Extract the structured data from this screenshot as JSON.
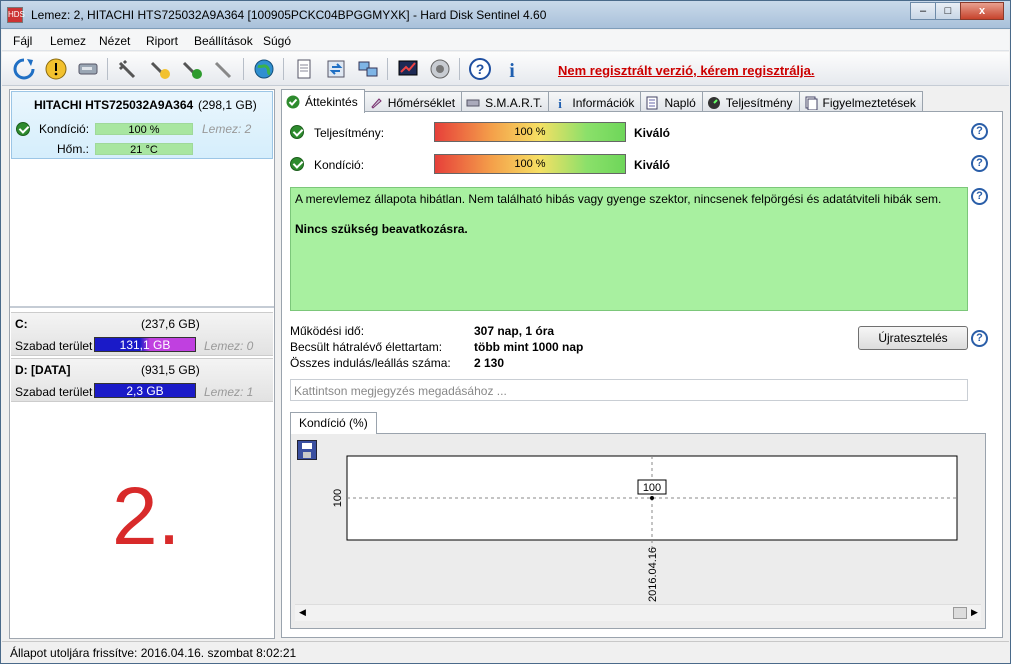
{
  "window": {
    "title": "Lemez: 2, HITACHI HTS725032A9A364 [100905PCKC04BPGGMYXK]  -  Hard Disk Sentinel 4.60",
    "app_icon_text": "HDS",
    "buttons": {
      "minimize": "–",
      "maximize": "□",
      "close": "x"
    }
  },
  "menu": [
    "Fájl",
    "Lemez",
    "Nézet",
    "Riport",
    "Beállítások",
    "Súgó"
  ],
  "toolbar": {
    "icons": [
      "refresh-icon",
      "warning-icon",
      "disk-icon",
      "plug-icon",
      "plug-warning-icon",
      "plug-ok-icon",
      "plug-gray-icon",
      "globe-icon",
      "document-icon",
      "sync-icon",
      "network-icon",
      "chart-icon",
      "speaker-icon",
      "help-icon",
      "info-icon"
    ],
    "registration_note": "Nem regisztrált verzió, kérem regisztrálja."
  },
  "sidebar": {
    "disk": {
      "name": "HITACHI HTS725032A9A364",
      "capacity": "(298,1 GB)",
      "condition_label": "Kondíció:",
      "condition_value": "100 %",
      "condition_percent": 100,
      "temp_label": "Hőm.:",
      "temp_value": "21 °C",
      "lemez": "Lemez: 2"
    },
    "volumes": [
      {
        "name": "C:",
        "capacity": "(237,6 GB)",
        "free_label": "Szabad terület",
        "free_value": "131,1 GB",
        "lemez": "Lemez: 0",
        "bar_color": "#b030d0"
      },
      {
        "name": "D: [DATA]",
        "capacity": "(931,5 GB)",
        "free_label": "Szabad terület",
        "free_value": "2,3 GB",
        "lemez": "Lemez: 1",
        "bar_color": "#1a1ac8"
      }
    ],
    "big_number": "2."
  },
  "tabs": [
    {
      "label": "Áttekintés",
      "icon": "check-icon",
      "active": true
    },
    {
      "label": "Hőmérséklet",
      "icon": "thermometer-icon",
      "active": false
    },
    {
      "label": "S.M.A.R.T.",
      "icon": "smart-icon",
      "active": false
    },
    {
      "label": "Információk",
      "icon": "info-icon",
      "active": false
    },
    {
      "label": "Napló",
      "icon": "log-icon",
      "active": false
    },
    {
      "label": "Teljesítmény",
      "icon": "gauge-icon",
      "active": false
    },
    {
      "label": "Figyelmeztetések",
      "icon": "alerts-icon",
      "active": false
    }
  ],
  "overview": {
    "performance_label": "Teljesítmény:",
    "performance_value": "100 %",
    "performance_word": "Kiváló",
    "condition_label": "Kondíció:",
    "condition_value": "100 %",
    "condition_word": "Kiváló",
    "status_text": "A merevlemez állapota hibátlan. Nem található hibás vagy gyenge szektor, nincsenek felpörgési és adatátviteli hibák sem.",
    "status_action": "Nincs szükség beavatkozásra.",
    "stats": [
      {
        "label": "Működési idő:",
        "value": "307 nap, 1 óra"
      },
      {
        "label": "Becsült hátralévő élettartam:",
        "value": "több mint 1000 nap"
      },
      {
        "label": "Összes indulás/leállás száma:",
        "value": "2 130"
      }
    ],
    "retest_button": "Újratesztelés",
    "note_placeholder": "Kattintson megjegyzés megadásához ...",
    "chart_tab_label": "Kondíció  (%)"
  },
  "chart_data": {
    "type": "line",
    "title": "",
    "x": [
      "2016.04.16"
    ],
    "series": [
      {
        "values": [
          100
        ]
      }
    ],
    "y_tick": "100",
    "point_label": "100",
    "grid": true
  },
  "statusbar": {
    "text": "Állapot utoljára frissítve: 2016.04.16. szombat 8:02:21"
  }
}
